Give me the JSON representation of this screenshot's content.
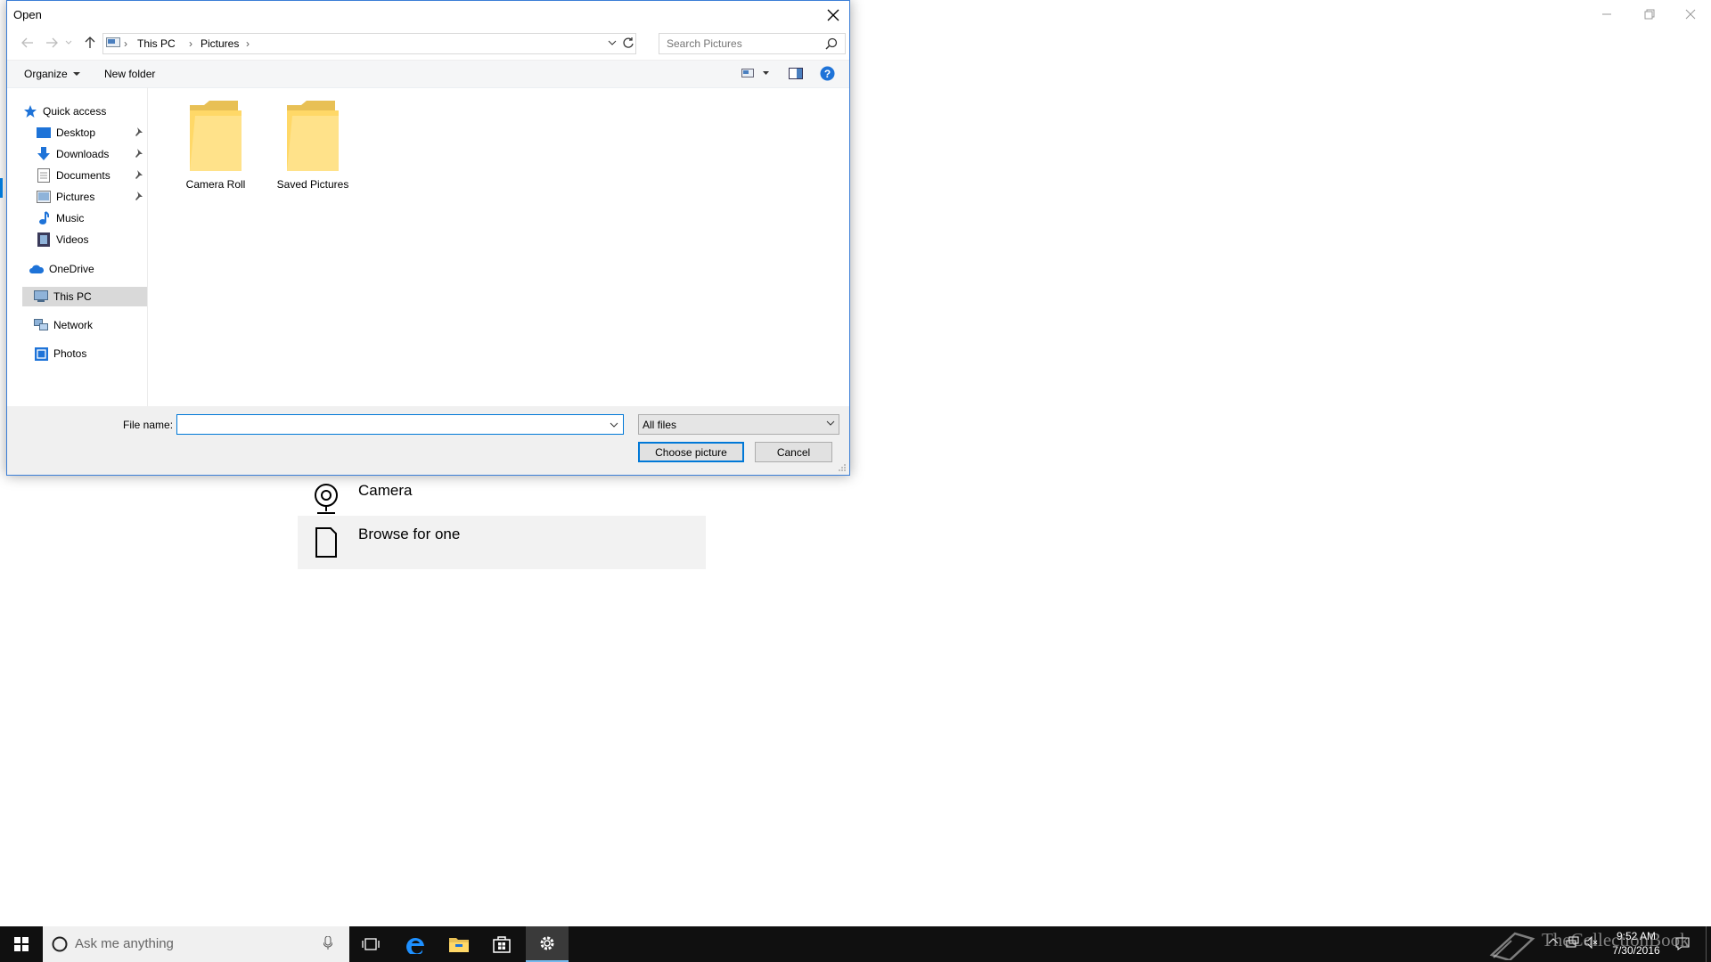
{
  "background_window": {
    "options": [
      {
        "label": "Camera",
        "icon": "camera-icon"
      },
      {
        "label": "Browse for one",
        "icon": "document-icon"
      }
    ]
  },
  "dialog": {
    "title": "Open",
    "breadcrumb": [
      "This PC",
      "Pictures"
    ],
    "search_placeholder": "Search Pictures",
    "toolbar": {
      "organize": "Organize",
      "new_folder": "New folder"
    },
    "nav": {
      "quick_access": "Quick access",
      "quick_items": [
        {
          "label": "Desktop",
          "pinned": true
        },
        {
          "label": "Downloads",
          "pinned": true
        },
        {
          "label": "Documents",
          "pinned": true
        },
        {
          "label": "Pictures",
          "pinned": true
        },
        {
          "label": "Music",
          "pinned": false
        },
        {
          "label": "Videos",
          "pinned": false
        }
      ],
      "onedrive": "OneDrive",
      "this_pc": "This PC",
      "network": "Network",
      "photos": "Photos"
    },
    "folders": [
      "Camera Roll",
      "Saved Pictures"
    ],
    "file_name_label": "File name:",
    "file_name_value": "",
    "file_type": "All files",
    "buttons": {
      "choose": "Choose picture",
      "cancel": "Cancel"
    }
  },
  "taskbar": {
    "search_placeholder": "Ask me anything",
    "time": "9:52 AM",
    "date": "7/30/2016",
    "watermark": "TheCollectionBook"
  },
  "colors": {
    "accent": "#0078d7",
    "taskbar": "#101010",
    "folder": "#ffd867"
  }
}
